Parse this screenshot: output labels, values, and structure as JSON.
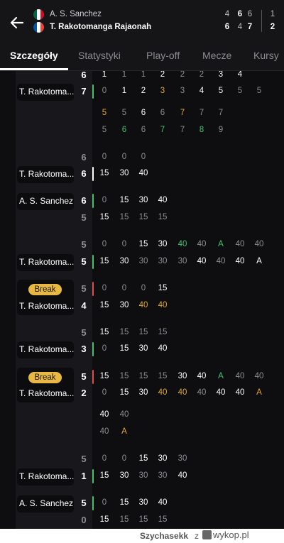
{
  "header": {
    "players": [
      {
        "name": "A. S. Sanchez",
        "flag": [
          "#006847",
          "#ffffff",
          "#ce1126"
        ],
        "sets": [
          "4",
          "6",
          "6"
        ],
        "sets_won": "1"
      },
      {
        "name": "T. Rakotomanga Rajaonah",
        "flag": [
          "#0055a4",
          "#ffffff",
          "#ef4135"
        ],
        "sets": [
          "6",
          "4",
          "7"
        ],
        "sets_won": "2"
      }
    ]
  },
  "tabs": [
    {
      "label": "Szczegóły",
      "active": true
    },
    {
      "label": "Statystyki"
    },
    {
      "label": "Play-off"
    },
    {
      "label": "Mecze"
    },
    {
      "label": "Kursy"
    }
  ],
  "colors": {
    "green": "#3ec46d",
    "yellow": "#e0a72e",
    "red": "#e04b4b",
    "grey": "#8e8e93",
    "white": "#ffffff"
  },
  "games": [
    {
      "rows": [
        {
          "score": "6",
          "partial": true,
          "points": [
            [
              "1",
              "w"
            ],
            [
              "1",
              "g"
            ],
            [
              "1",
              "g"
            ],
            [
              "2",
              "w"
            ],
            [
              "2",
              "g"
            ],
            [
              "2",
              "g"
            ],
            [
              "3",
              "w"
            ],
            [
              "4",
              "w"
            ]
          ]
        },
        {
          "label": "T. Rakotoma...",
          "score": "7",
          "bar": "green",
          "points": [
            [
              "0",
              "g"
            ],
            [
              "1",
              "w"
            ],
            [
              "2",
              "w"
            ],
            [
              "3",
              "y"
            ],
            [
              "3",
              "g"
            ],
            [
              "4",
              "w"
            ],
            [
              "5",
              "w"
            ],
            [
              "5",
              "g"
            ],
            [
              "5",
              "g"
            ]
          ]
        }
      ]
    },
    {
      "tiebreak": true,
      "rows": [
        {
          "points": [
            [
              "5",
              "y"
            ],
            [
              "5",
              "g"
            ],
            [
              "6",
              "w"
            ],
            [
              "6",
              "g"
            ],
            [
              "7",
              "y"
            ],
            [
              "7",
              "g"
            ],
            [
              "7",
              "g"
            ]
          ]
        },
        {
          "points": [
            [
              "5",
              "g"
            ],
            [
              "6",
              "G"
            ],
            [
              "6",
              "g"
            ],
            [
              "7",
              "G"
            ],
            [
              "7",
              "g"
            ],
            [
              "8",
              "G"
            ],
            [
              "9",
              "g"
            ]
          ]
        }
      ]
    },
    {
      "rows": [
        {
          "score": "6",
          "dim": true,
          "points": [
            [
              "0",
              "g"
            ],
            [
              "0",
              "g"
            ],
            [
              "0",
              "g"
            ]
          ]
        },
        {
          "label": "T. Rakotoma...",
          "score": "6",
          "bar": "white",
          "points": [
            [
              "15",
              "w"
            ],
            [
              "30",
              "w"
            ],
            [
              "40",
              "w"
            ]
          ]
        }
      ]
    },
    {
      "rows": [
        {
          "label": "A. S. Sanchez",
          "score": "6",
          "bar": "green",
          "points": [
            [
              "0",
              "g"
            ],
            [
              "15",
              "w"
            ],
            [
              "30",
              "w"
            ],
            [
              "40",
              "w"
            ]
          ]
        },
        {
          "score": "5",
          "dim": true,
          "points": [
            [
              "15",
              "w"
            ],
            [
              "15",
              "g"
            ],
            [
              "15",
              "g"
            ],
            [
              "15",
              "g"
            ]
          ]
        }
      ]
    },
    {
      "rows": [
        {
          "score": "5",
          "dim": true,
          "points": [
            [
              "0",
              "g"
            ],
            [
              "0",
              "g"
            ],
            [
              "15",
              "w"
            ],
            [
              "30",
              "w"
            ],
            [
              "40",
              "G"
            ],
            [
              "40",
              "g"
            ],
            [
              "A",
              "G"
            ],
            [
              "40",
              "g"
            ],
            [
              "40",
              "g"
            ]
          ]
        },
        {
          "label": "T. Rakotoma...",
          "score": "5",
          "bar": "green",
          "points": [
            [
              "15",
              "w"
            ],
            [
              "30",
              "w"
            ],
            [
              "30",
              "g"
            ],
            [
              "30",
              "g"
            ],
            [
              "30",
              "g"
            ],
            [
              "40",
              "w"
            ],
            [
              "40",
              "g"
            ],
            [
              "40",
              "w"
            ],
            [
              "A",
              "w"
            ]
          ]
        }
      ]
    },
    {
      "break": "Break",
      "rows": [
        {
          "score": "5",
          "dim": true,
          "bar": "red",
          "points": [
            [
              "0",
              "g"
            ],
            [
              "0",
              "g"
            ],
            [
              "0",
              "g"
            ],
            [
              "15",
              "w"
            ]
          ]
        },
        {
          "label": "T. Rakotoma...",
          "score": "4",
          "points": [
            [
              "15",
              "w"
            ],
            [
              "30",
              "w"
            ],
            [
              "40",
              "y"
            ],
            [
              "40",
              "y"
            ]
          ]
        }
      ]
    },
    {
      "rows": [
        {
          "score": "5",
          "dim": true,
          "points": [
            [
              "15",
              "w"
            ],
            [
              "15",
              "g"
            ],
            [
              "15",
              "g"
            ],
            [
              "15",
              "g"
            ]
          ]
        },
        {
          "label": "T. Rakotoma...",
          "score": "3",
          "bar": "green",
          "points": [
            [
              "0",
              "g"
            ],
            [
              "15",
              "w"
            ],
            [
              "30",
              "w"
            ],
            [
              "40",
              "w"
            ]
          ]
        }
      ]
    },
    {
      "break": "Break",
      "rows": [
        {
          "score": "5",
          "bar": "red",
          "points": [
            [
              "15",
              "w"
            ],
            [
              "15",
              "g"
            ],
            [
              "15",
              "g"
            ],
            [
              "15",
              "g"
            ],
            [
              "30",
              "w"
            ],
            [
              "40",
              "w"
            ],
            [
              "A",
              "G"
            ],
            [
              "40",
              "g"
            ],
            [
              "40",
              "g"
            ]
          ]
        },
        {
          "label": "T. Rakotoma...",
          "score": "2",
          "points": [
            [
              "0",
              "g"
            ],
            [
              "15",
              "w"
            ],
            [
              "30",
              "w"
            ],
            [
              "40",
              "y"
            ],
            [
              "40",
              "y"
            ],
            [
              "40",
              "g"
            ],
            [
              "40",
              "w"
            ],
            [
              "40",
              "w"
            ],
            [
              "A",
              "y"
            ]
          ]
        }
      ]
    },
    {
      "deuce": true,
      "rows": [
        {
          "points": [
            [
              "40",
              "w"
            ],
            [
              "40",
              "g"
            ]
          ]
        },
        {
          "points": [
            [
              "40",
              "g"
            ],
            [
              "A",
              "y"
            ]
          ]
        }
      ]
    },
    {
      "rows": [
        {
          "score": "5",
          "dim": true,
          "points": [
            [
              "0",
              "g"
            ],
            [
              "0",
              "g"
            ],
            [
              "15",
              "w"
            ],
            [
              "30",
              "w"
            ],
            [
              "30",
              "g"
            ]
          ]
        },
        {
          "label": "T. Rakotoma...",
          "score": "1",
          "bar": "green",
          "points": [
            [
              "15",
              "w"
            ],
            [
              "30",
              "w"
            ],
            [
              "30",
              "g"
            ],
            [
              "30",
              "g"
            ],
            [
              "40",
              "w"
            ]
          ]
        }
      ]
    },
    {
      "rows": [
        {
          "label": "A. S. Sanchez",
          "score": "5",
          "bar": "green",
          "points": [
            [
              "0",
              "g"
            ],
            [
              "15",
              "w"
            ],
            [
              "30",
              "w"
            ],
            [
              "40",
              "w"
            ]
          ]
        },
        {
          "score": "0",
          "dim": true,
          "points": [
            [
              "15",
              "w"
            ],
            [
              "15",
              "g"
            ],
            [
              "15",
              "g"
            ],
            [
              "15",
              "g"
            ]
          ]
        }
      ]
    }
  ],
  "footer": {
    "user": "Szychasekk",
    "separator": "z",
    "site": "wykop.pl"
  }
}
